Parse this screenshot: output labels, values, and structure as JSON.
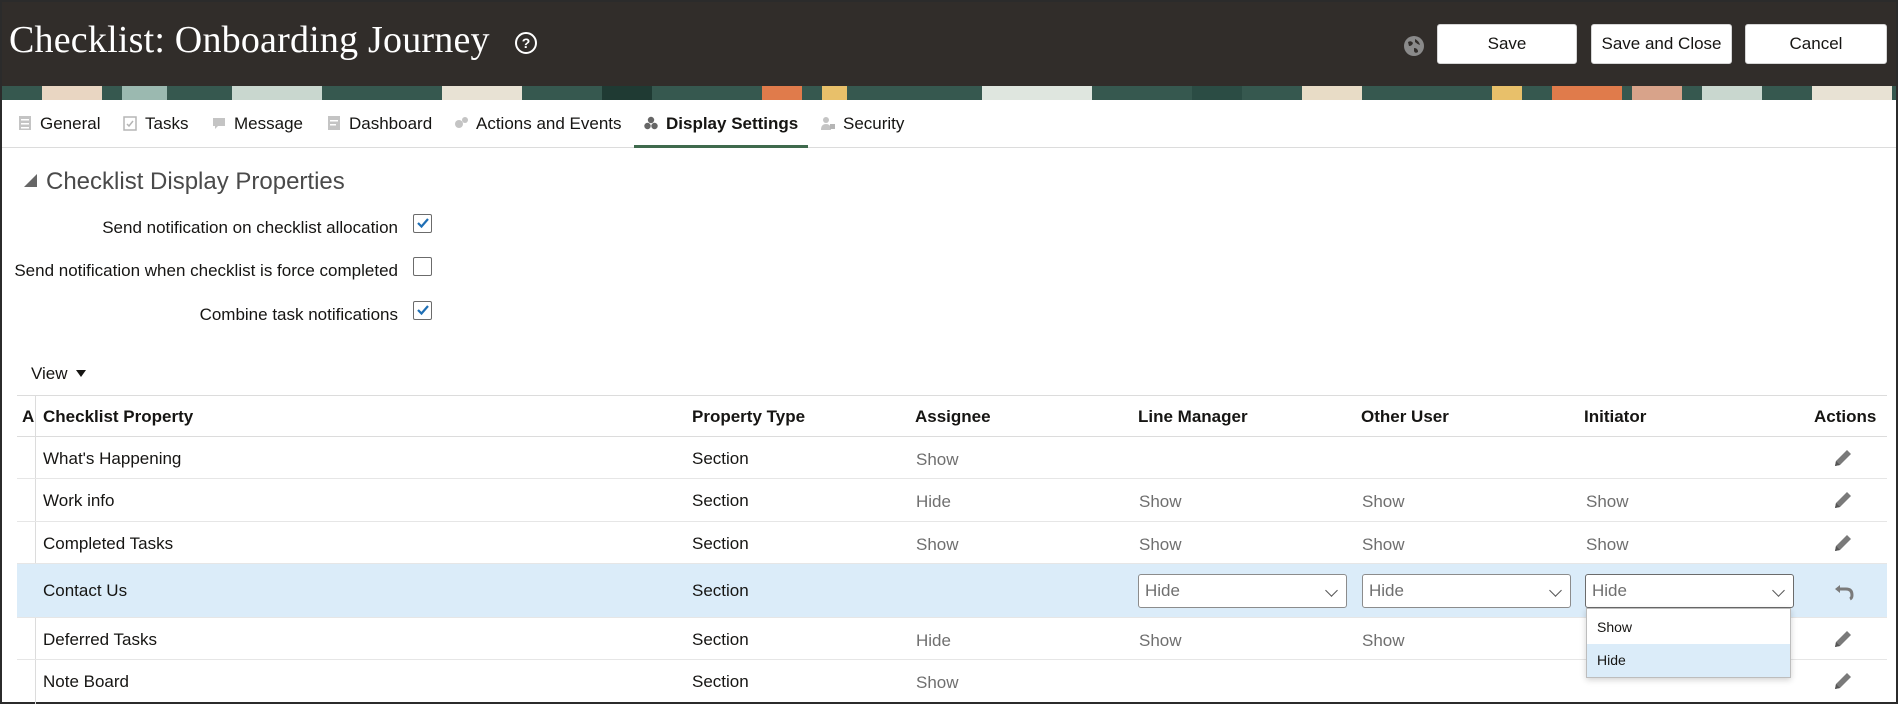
{
  "header": {
    "title": "Checklist: Onboarding Journey",
    "help_glyph": "?",
    "icons": [
      "help-icon",
      "globe-icon"
    ],
    "buttons": {
      "save": "Save",
      "save_and_close": "Save and Close",
      "cancel": "Cancel"
    },
    "colors": {
      "header_bg": "#312d2a",
      "accent": "#3f6a4d"
    }
  },
  "tabs": [
    {
      "label": "General",
      "icon": "general-icon"
    },
    {
      "label": "Tasks",
      "icon": "tasks-icon"
    },
    {
      "label": "Message",
      "icon": "message-icon"
    },
    {
      "label": "Dashboard",
      "icon": "dashboard-icon"
    },
    {
      "label": "Actions and Events",
      "icon": "actions-icon"
    },
    {
      "label": "Display Settings",
      "icon": "display-settings-icon",
      "active": true
    },
    {
      "label": "Security",
      "icon": "security-icon"
    }
  ],
  "section": {
    "title": "Checklist Display Properties",
    "properties": [
      {
        "label": "Send notification on checklist allocation",
        "checked": true
      },
      {
        "label": "Send notification when checklist is force completed",
        "checked": false
      },
      {
        "label": "Combine task notifications",
        "checked": true
      }
    ]
  },
  "view_menu": {
    "label": "View"
  },
  "table": {
    "columns": [
      "A",
      "Checklist Property",
      "Property Type",
      "Assignee",
      "Line Manager",
      "Other User",
      "Initiator",
      "Actions"
    ],
    "rows": [
      {
        "property": "What's Happening",
        "type": "Section",
        "assignee": "Show",
        "line_manager": "",
        "other_user": "",
        "initiator": ""
      },
      {
        "property": "Work info",
        "type": "Section",
        "assignee": "Hide",
        "line_manager": "Show",
        "other_user": "Show",
        "initiator": "Show"
      },
      {
        "property": "Completed Tasks",
        "type": "Section",
        "assignee": "Show",
        "line_manager": "Show",
        "other_user": "Show",
        "initiator": "Show"
      },
      {
        "property": "Contact Us",
        "type": "Section",
        "assignee": "",
        "line_manager": "Hide",
        "other_user": "Hide",
        "initiator": "Hide",
        "editing": true
      },
      {
        "property": "Deferred Tasks",
        "type": "Section",
        "assignee": "Hide",
        "line_manager": "Show",
        "other_user": "Show",
        "initiator": ""
      },
      {
        "property": "Note Board",
        "type": "Section",
        "assignee": "Show",
        "line_manager": "",
        "other_user": "",
        "initiator": ""
      }
    ]
  },
  "dropdown": {
    "options": [
      "Show",
      "Hide"
    ],
    "highlighted": "Hide"
  }
}
